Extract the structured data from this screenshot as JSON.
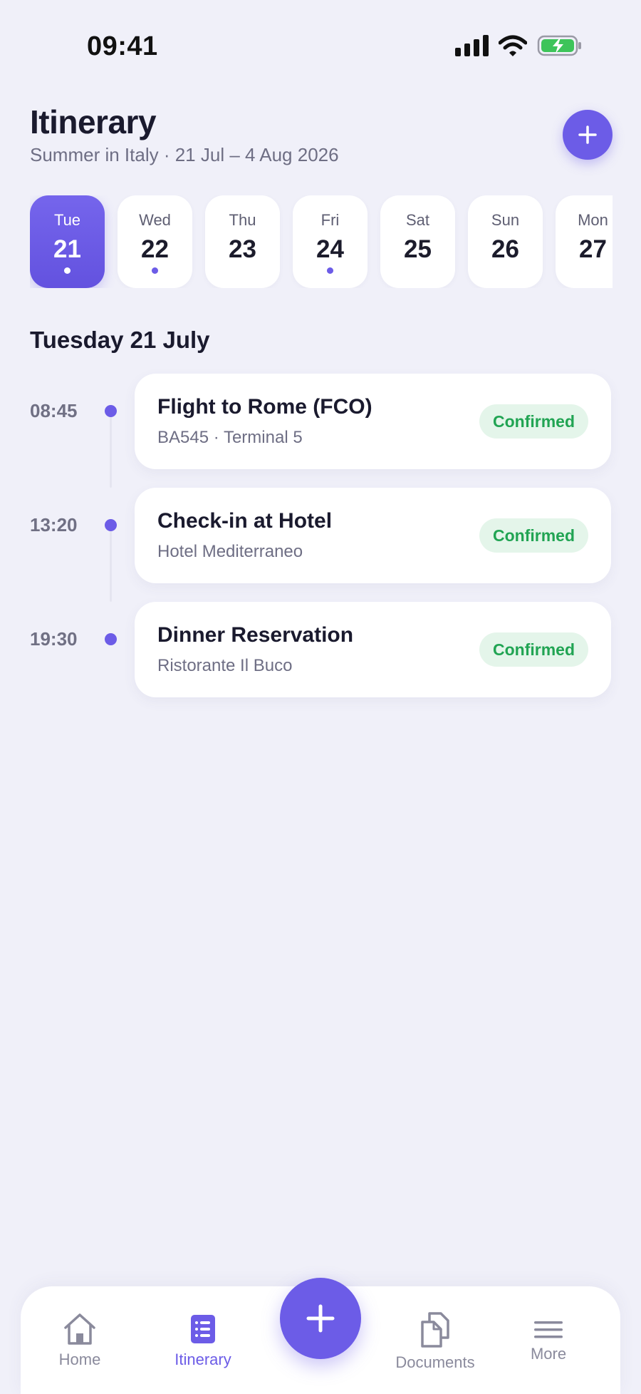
{
  "status_bar": {
    "time": "09:41"
  },
  "header": {
    "title": "Itinerary",
    "subtitle": "Summer in Italy · 21 Jul – 4 Aug 2026"
  },
  "days": [
    {
      "name": "Tue",
      "num": "21",
      "selected": true,
      "has_events": true
    },
    {
      "name": "Wed",
      "num": "22",
      "selected": false,
      "has_events": true
    },
    {
      "name": "Thu",
      "num": "23",
      "selected": false,
      "has_events": false
    },
    {
      "name": "Fri",
      "num": "24",
      "selected": false,
      "has_events": true
    },
    {
      "name": "Sat",
      "num": "25",
      "selected": false,
      "has_events": false
    },
    {
      "name": "Sun",
      "num": "26",
      "selected": false,
      "has_events": false
    },
    {
      "name": "Mon",
      "num": "27",
      "selected": false,
      "has_events": false
    }
  ],
  "section_heading": "Tuesday 21 July",
  "events": [
    {
      "time": "08:45",
      "title": "Flight to Rome (FCO)",
      "subtitle": "BA545 · Terminal 5",
      "status": "Confirmed"
    },
    {
      "time": "13:20",
      "title": "Check-in at Hotel",
      "subtitle": "Hotel Mediterraneo",
      "status": "Confirmed"
    },
    {
      "time": "19:30",
      "title": "Dinner Reservation",
      "subtitle": "Ristorante Il Buco",
      "status": "Confirmed"
    }
  ],
  "nav": {
    "home_label": "Home",
    "itinerary_label": "Itinerary",
    "documents_label": "Documents",
    "more_label": "More",
    "active": "itinerary"
  },
  "colors": {
    "accent": "#6C5CE7",
    "background": "#F0F0F9",
    "confirmed_text": "#21A453",
    "confirmed_bg": "#E4F5EA",
    "battery_fill": "#3DC45A"
  }
}
